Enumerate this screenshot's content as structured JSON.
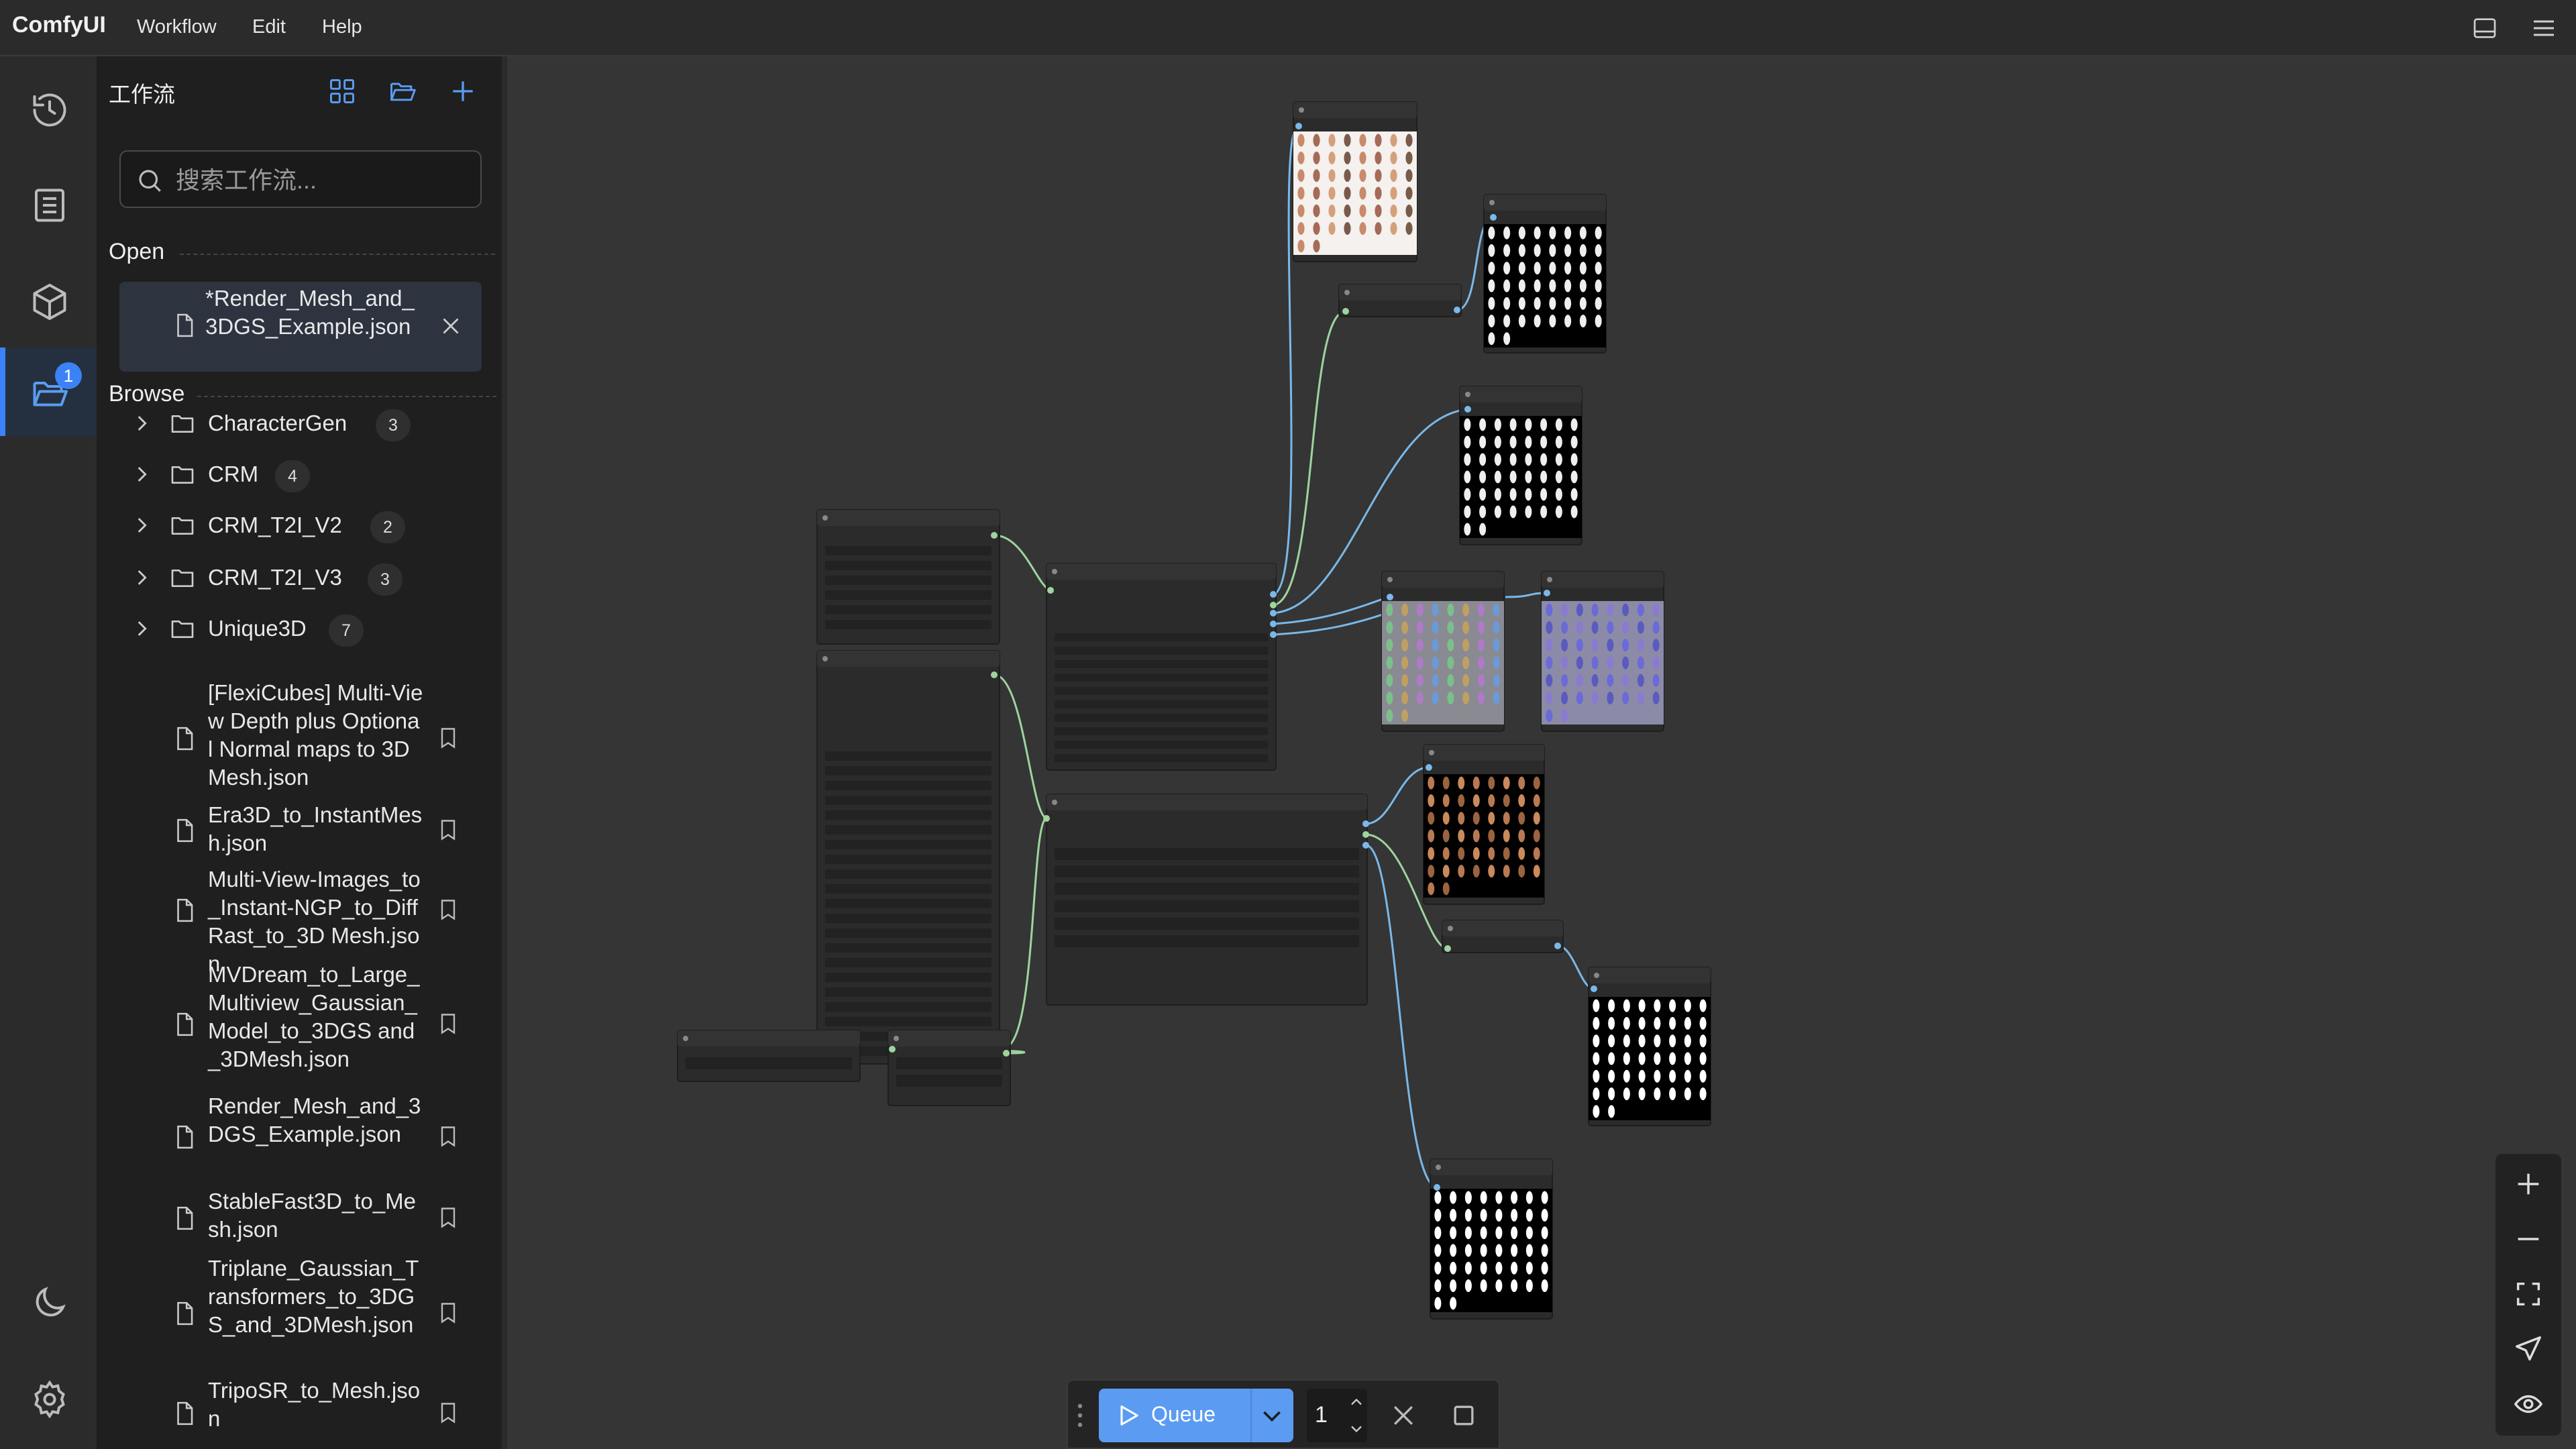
{
  "app": {
    "brand": "ComfyUI"
  },
  "menu": {
    "workflow": "Workflow",
    "edit": "Edit",
    "help": "Help"
  },
  "rail": {
    "items": [
      {
        "name": "history",
        "icon": "history-icon"
      },
      {
        "name": "queue",
        "icon": "list-icon"
      },
      {
        "name": "model-library",
        "icon": "cube-icon"
      },
      {
        "name": "workflows",
        "icon": "folder-open-icon",
        "badge": "1",
        "active": true
      }
    ],
    "bottom": [
      {
        "name": "theme",
        "icon": "moon-icon"
      },
      {
        "name": "settings",
        "icon": "gear-icon"
      }
    ]
  },
  "panel": {
    "title": "工作流",
    "search_placeholder": "搜索工作流...",
    "open_label": "Open",
    "browse_label": "Browse",
    "open_items": [
      {
        "label": "*Render_Mesh_and_3DGS_Example.json"
      }
    ],
    "folders": [
      {
        "name": "CharacterGen",
        "count": "3"
      },
      {
        "name": "CRM",
        "count": "4"
      },
      {
        "name": "CRM_T2I_V2",
        "count": "2"
      },
      {
        "name": "CRM_T2I_V3",
        "count": "3"
      },
      {
        "name": "Unique3D",
        "count": "7"
      }
    ],
    "files": [
      "[FlexiCubes] Multi-View Depth plus Optional Normal maps to 3D Mesh.json",
      "Era3D_to_InstantMesh.json",
      "Multi-View-Images_to_Instant-NGP_to_DiffRast_to_3D Mesh.json",
      "MVDream_to_Large_Multiview_Gaussian_Model_to_3DGS and_3DMesh.json",
      "Render_Mesh_and_3DGS_Example.json",
      "StableFast3D_to_Mesh.json",
      "Triplane_Gaussian_Transformers_to_3DGS_and_3DMesh.json",
      "TripoSR_to_Mesh.json"
    ]
  },
  "queue": {
    "label": "Queue",
    "count": "1"
  },
  "colors": {
    "accent": "#3b82f6",
    "queue_button": "#5b9cf2",
    "link_blue": "#7ab8e8",
    "link_green": "#9ed49e"
  }
}
